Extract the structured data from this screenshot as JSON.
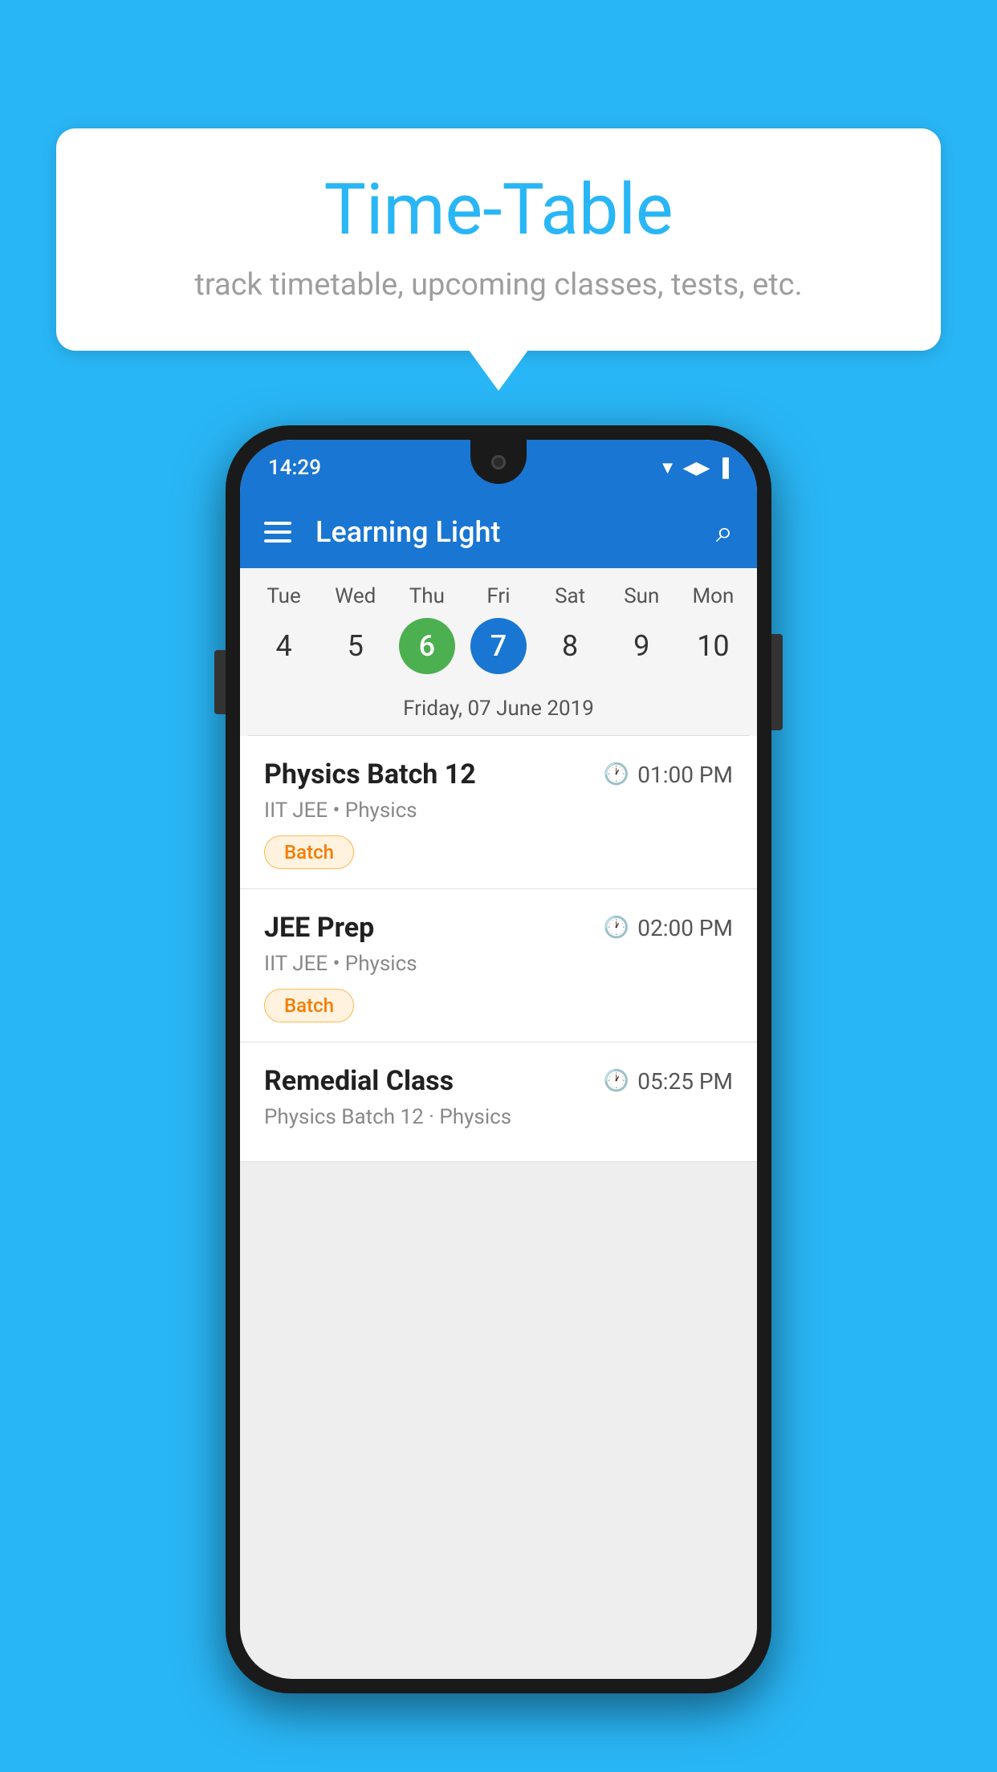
{
  "background_color": "#29B6F6",
  "bubble": {
    "title": "Time-Table",
    "subtitle": "track timetable, upcoming classes, tests, etc."
  },
  "phone": {
    "status_bar": {
      "time": "14:29"
    },
    "app_bar": {
      "title": "Learning Light"
    },
    "calendar": {
      "days": [
        "Tue",
        "Wed",
        "Thu",
        "Fri",
        "Sat",
        "Sun",
        "Mon"
      ],
      "dates": [
        "4",
        "5",
        "6",
        "7",
        "8",
        "9",
        "10"
      ],
      "today_index": 2,
      "selected_index": 3,
      "selected_date_label": "Friday, 07 June 2019"
    },
    "schedule": [
      {
        "name": "Physics Batch 12",
        "time": "01:00 PM",
        "meta": "IIT JEE • Physics",
        "badge": "Batch"
      },
      {
        "name": "JEE Prep",
        "time": "02:00 PM",
        "meta": "IIT JEE • Physics",
        "badge": "Batch"
      },
      {
        "name": "Remedial Class",
        "time": "05:25 PM",
        "meta": "Physics Batch 12 · Physics",
        "badge": null
      }
    ]
  }
}
